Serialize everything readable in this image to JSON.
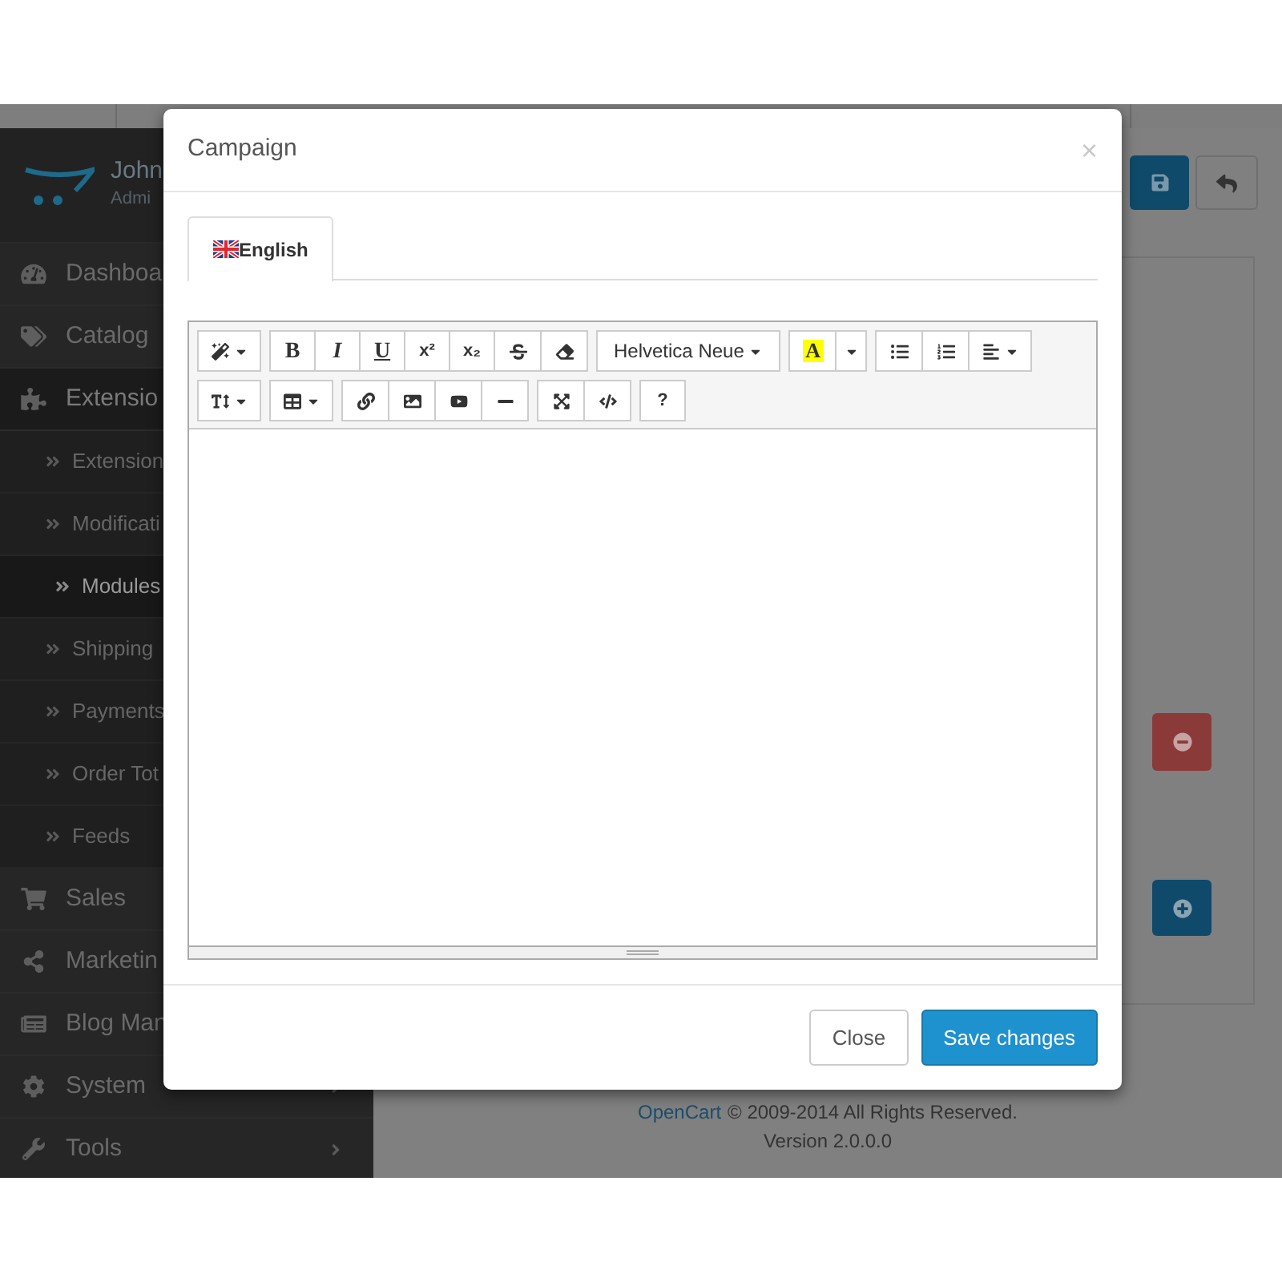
{
  "sidebar": {
    "profile": {
      "name": "John",
      "role": "Admi"
    },
    "items": [
      {
        "label": "Dashboa",
        "expanded": false
      },
      {
        "label": "Catalog",
        "expanded": false
      },
      {
        "label": "Extensio",
        "expanded": true,
        "children": [
          {
            "label": "Extension",
            "selected": false
          },
          {
            "label": "Modificati",
            "selected": false
          },
          {
            "label": "Modules",
            "selected": true
          },
          {
            "label": "Shipping",
            "selected": false
          },
          {
            "label": "Payments",
            "selected": false
          },
          {
            "label": "Order Tot",
            "selected": false
          },
          {
            "label": "Feeds",
            "selected": false
          }
        ]
      },
      {
        "label": "Sales",
        "expanded": false
      },
      {
        "label": "Marketin",
        "expanded": false
      },
      {
        "label": "Blog Man",
        "expanded": false
      },
      {
        "label": "System",
        "expanded": false
      },
      {
        "label": "Tools",
        "expanded": false
      }
    ]
  },
  "footer": {
    "link": "OpenCart",
    "text": "© 2009-2014 All Rights Reserved.",
    "version": "Version 2.0.0.0"
  },
  "modal": {
    "title": "Campaign",
    "close": "×",
    "tabs": [
      {
        "label": "English",
        "selected": true
      }
    ],
    "toolbar": [
      [
        [
          {
            "kind": "icon-dropdown"
          }
        ],
        [
          {
            "kind": "text",
            "label": "B"
          },
          {
            "kind": "text",
            "label": "I"
          },
          {
            "kind": "text",
            "label": "U"
          },
          {
            "kind": "text",
            "label": "x²"
          },
          {
            "kind": "text",
            "label": "x₂"
          },
          {
            "kind": "icon"
          },
          {
            "kind": "icon"
          }
        ],
        [
          {
            "kind": "dropdown",
            "label": "Helvetica Neue"
          }
        ],
        [
          {
            "kind": "color",
            "label": "A"
          },
          {
            "kind": "caret"
          }
        ],
        [
          {
            "kind": "icon"
          },
          {
            "kind": "icon"
          },
          {
            "kind": "icon-dropdown"
          }
        ]
      ],
      [
        [
          {
            "kind": "icon-dropdown"
          }
        ],
        [
          {
            "kind": "icon-dropdown"
          }
        ],
        [
          {
            "kind": "icon"
          },
          {
            "kind": "icon"
          },
          {
            "kind": "icon"
          },
          {
            "kind": "icon"
          }
        ],
        [
          {
            "kind": "icon"
          },
          {
            "kind": "icon"
          }
        ],
        [
          {
            "kind": "text",
            "label": "?"
          }
        ]
      ]
    ],
    "buttons": [
      {
        "label": "Close",
        "kind": "default"
      },
      {
        "label": "Save changes",
        "kind": "primary"
      }
    ]
  }
}
